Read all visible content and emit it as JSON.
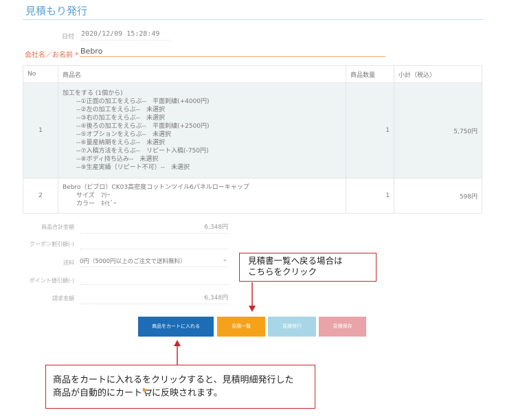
{
  "page": {
    "title": "見積もり発行"
  },
  "form": {
    "date_label": "日付",
    "date_value": "2020/12/09 15:28:49",
    "name_label": "会社名／お名前 *",
    "name_value": "Bebro"
  },
  "table": {
    "headers": {
      "no": "No",
      "name": "商品名",
      "qty": "商品数量",
      "subtotal": "小計（税込）"
    },
    "rows": [
      {
        "no": "1",
        "name": "加工をする (1個から)",
        "options": [
          "--①正面の加工をえらぶ--　平面刺繍(+4000円)",
          "--②左の加工をえらぶ--　未選択",
          "--③右の加工をえらぶ--　未選択",
          "--④後ろの加工をえらぶ--　平面刺繍(+2500円)",
          "--⑤オプションをえらぶ--　未選択",
          "--⑥量産納期をえらぶ--　未選択",
          "--⑦入稿方法をえらぶ--　リピート入稿(-750円)",
          "--⑧ボディ持ち込み--　未選択",
          "--⑨生産実績（リピート不可）--　未選択"
        ],
        "qty": "1",
        "subtotal": "5,750円"
      },
      {
        "no": "2",
        "name": "Bebro（ビブロ）CK03高密度コットンツイル6パネルローキャップ",
        "options": [
          "サイズ　ﾌﾘｰ",
          "カラー　ﾈｲﾋﾞｰ"
        ],
        "qty": "1",
        "subtotal": "598円"
      }
    ]
  },
  "summary": {
    "goods_total_label": "商品合計金額",
    "goods_total_value": "6,348円",
    "coupon_label": "クーポン割引額(-)",
    "shipping_label": "送料",
    "shipping_selected": "0円（5000円以上のご注文で送料無料）",
    "points_label": "ポイント値引額(-)",
    "billing_label": "請求金額",
    "billing_value": "6,348円"
  },
  "buttons": {
    "add_to_cart": "商品をカートに入れる",
    "quote_list": "見積一覧",
    "quote_issue": "見積発行",
    "quote_save": "見積保存"
  },
  "callouts": {
    "list_line1": "見積書一覧へ戻る場合は",
    "list_line2": "こちらをクリック",
    "cart_line1": "商品をカートに入れるをクリックすると、見積明細発行した",
    "cart_line2a": "商品が自動的にカート",
    "cart_line2b": "に反映されます。"
  },
  "icons": {
    "cart": "shopping-cart-icon",
    "dropdown": "chevron-down-icon"
  },
  "colors": {
    "title": "#5ba3d6",
    "required_label": "#e06a4a",
    "cart_button": "#1c6cb6",
    "list_button": "#f5a21a",
    "issue_button": "#a8d6e6",
    "save_button": "#e8a4a8",
    "callout_border": "#c9252a"
  }
}
